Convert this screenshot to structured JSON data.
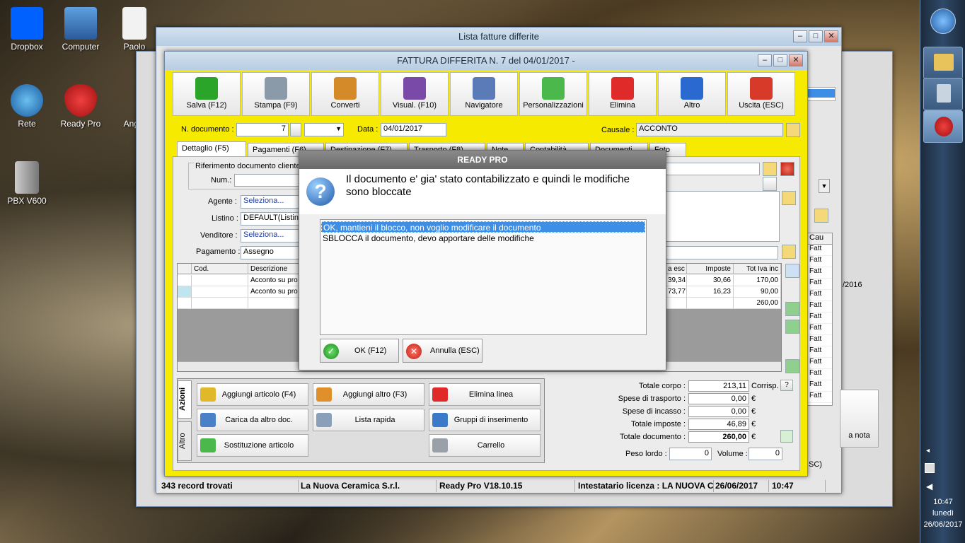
{
  "desktop": {
    "icons": [
      {
        "label": "Dropbox",
        "color": "#0061fe"
      },
      {
        "label": "Computer",
        "color": "#4a87c8"
      },
      {
        "label": "Paolo",
        "color": "#f2f2f2"
      },
      {
        "label": "Rete",
        "color": "#2d7fc8"
      },
      {
        "label": "Ready Pro",
        "color": "#d21c1c"
      },
      {
        "label": "Angel",
        "color": "#ffffff"
      },
      {
        "label": "PBX V600",
        "color": "#9aa0a8"
      }
    ]
  },
  "taskbar": {
    "time": "10:47",
    "day": "lunedì",
    "date": "26/06/2017"
  },
  "back_window": {
    "title": "Lista fatture differite",
    "status": [
      "343 record trovati",
      "La Nuova Ceramica S.r.l.",
      "Ready Pro V18.10.15",
      "Intestatario licenza : LA NUOVA CE",
      "26/06/2017",
      "10:47"
    ],
    "cau_header": "Cau",
    "cau_rows": [
      "Fatt",
      "Fatt",
      "Fatt",
      "Fatt",
      "Fatt",
      "Fatt",
      "Fatt",
      "Fatt",
      "Fatt",
      "Fatt",
      "Fatt",
      "Fatt",
      "Fatt",
      "Fatt"
    ],
    "date_cell": "/2016",
    "nota_label": "a nota",
    "esc_label": "SC)"
  },
  "invoice": {
    "title": "FATTURA DIFFERITA N. 7 del 04/01/2017 -",
    "toolbar": [
      {
        "label": "Salva (F12)",
        "color": "#2aa52a"
      },
      {
        "label": "Stampa (F9)",
        "color": "#8a9aa8"
      },
      {
        "label": "Converti",
        "color": "#d58a2a"
      },
      {
        "label": "Visual. (F10)",
        "color": "#7a4aa8"
      },
      {
        "label": "Navigatore",
        "color": "#5a7ab8"
      },
      {
        "label": "Personalizzazioni",
        "color": "#4ab84a"
      },
      {
        "label": "Elimina",
        "color": "#e02a2a"
      },
      {
        "label": "Altro",
        "color": "#2a6ad0"
      },
      {
        "label": "Uscita (ESC)",
        "color": "#d83a2a"
      }
    ],
    "n_documento_label": "N. documento :",
    "n_documento": "7",
    "data_label": "Data :",
    "data": "04/01/2017",
    "causale_label": "Causale :",
    "causale": "ACCONTO",
    "tabs": [
      "Dettaglio (F5)",
      "Pagamenti (F6)",
      "Destinazione (F7)",
      "Trasporto (F8)",
      "Note",
      "Contabilità",
      "Documenti",
      "Foto"
    ],
    "rif_label": "Riferimento documento cliente",
    "num_label": "Num.:",
    "agente_label": "Agente :",
    "agente": "Seleziona...",
    "listino_label": "Listino :",
    "listino": "DEFAULT(Listino",
    "venditore_label": "Venditore :",
    "venditore": "Seleziona...",
    "pagamento_label": "Pagamento :",
    "pagamento": "Assegno",
    "grid": {
      "headers": [
        "Cod.",
        "Descrizione",
        "a esc",
        "Imposte",
        "Tot Iva inc"
      ],
      "rows": [
        {
          "cod": "",
          "descr": "Acconto su pro",
          "imp": "39,34",
          "iva": "30,66",
          "tot": "170,00"
        },
        {
          "cod": "",
          "descr": "Acconto su pro",
          "imp": "73,77",
          "iva": "16,23",
          "tot": "90,00"
        },
        {
          "cod": "",
          "descr": "",
          "imp": "",
          "iva": "",
          "tot": "260,00"
        }
      ]
    },
    "side_tabs": [
      "Azioni",
      "Altro"
    ],
    "actions": [
      {
        "label": "Aggiungi articolo (F4)",
        "color": "#e0b82a"
      },
      {
        "label": "Aggiungi altro (F3)",
        "color": "#e0902a"
      },
      {
        "label": "Elimina linea",
        "color": "#e02a2a"
      },
      {
        "label": "Carica da altro doc.",
        "color": "#4a80c8"
      },
      {
        "label": "Lista rapida",
        "color": "#8aa0b8"
      },
      {
        "label": "Gruppi di inserimento",
        "color": "#3a7ac8"
      },
      {
        "label": "Sostituzione articolo",
        "color": "#4ab84a"
      },
      {
        "label": "Carrello",
        "color": "#9aa0a8"
      }
    ],
    "totals": [
      {
        "label": "Totale corpo :",
        "value": "213,11",
        "unit": "Corrisp."
      },
      {
        "label": "Spese di trasporto :",
        "value": "0,00",
        "unit": "€"
      },
      {
        "label": "Spese di incasso :",
        "value": "0,00",
        "unit": "€"
      },
      {
        "label": "Totale imposte :",
        "value": "46,89",
        "unit": "€"
      },
      {
        "label": "Totale documento :",
        "value": "260,00",
        "unit": "€"
      }
    ],
    "corrisp_q": "?",
    "peso_label": "Peso lordo :",
    "peso": "0",
    "volume_label": "Volume :",
    "volume": "0"
  },
  "dialog": {
    "title": "READY PRO",
    "message": "Il documento e' gia' stato contabilizzato e quindi le modifiche sono bloccate",
    "options": [
      "OK, mantieni il blocco, non voglio modificare il documento",
      "SBLOCCA il documento, devo apportare delle modifiche"
    ],
    "ok": "OK (F12)",
    "cancel": "Annulla (ESC)"
  },
  "colors": {
    "accent_yellow": "#f5ea00",
    "selection": "#3f8ee6",
    "dialog_title": "#7a7a7a"
  }
}
